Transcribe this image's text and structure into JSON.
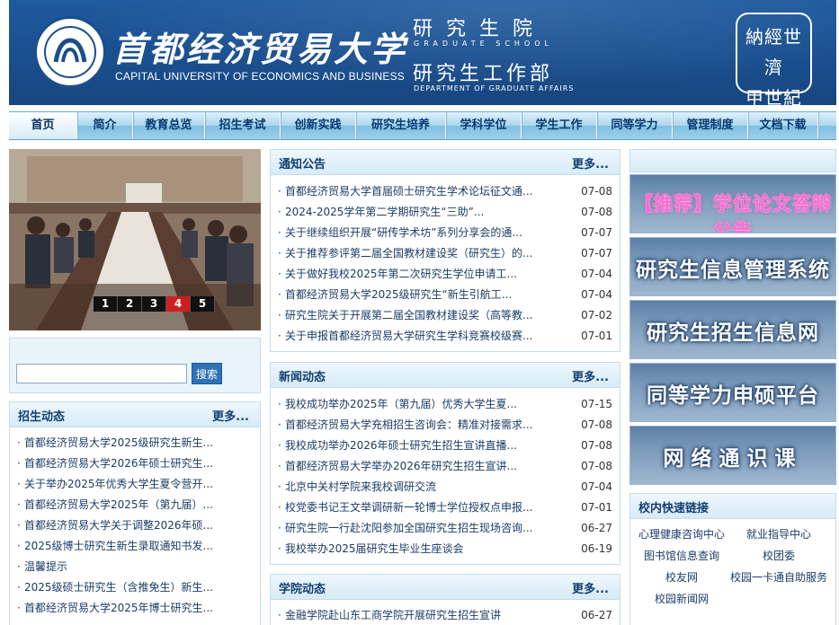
{
  "header": {
    "university_cn": "首都经济贸易大学",
    "university_en": "CAPITAL UNIVERSITY OF ECONOMICS AND BUSINESS",
    "dept1_cn": "研究生院",
    "dept1_en": "GRADUATE SCHOOL",
    "dept2_cn": "研究生工作部",
    "dept2_en": "DEPARTMENT OF GRADUATE AFFAIRS",
    "motto_line1": "納經世濟",
    "motto_line2": "甲世紀忠"
  },
  "nav": [
    {
      "label": "首页",
      "active": true
    },
    {
      "label": "简介"
    },
    {
      "label": "教育总览"
    },
    {
      "label": "招生考试"
    },
    {
      "label": "创新实践"
    },
    {
      "label": "研究生培养"
    },
    {
      "label": "学科学位"
    },
    {
      "label": "学生工作"
    },
    {
      "label": "同等学力"
    },
    {
      "label": "管理制度"
    },
    {
      "label": "文档下载"
    }
  ],
  "slider": {
    "pages": [
      "1",
      "2",
      "3",
      "4",
      "5"
    ],
    "active_page": "4"
  },
  "search": {
    "value": "",
    "button_label": "搜索"
  },
  "notices": {
    "title": "通知公告",
    "more": "更多...",
    "items": [
      {
        "text": "首都经济贸易大学首届硕士研究生学术论坛征文通...",
        "date": "07-08"
      },
      {
        "text": "2024-2025学年第二学期研究生“三助”...",
        "date": "07-08"
      },
      {
        "text": "关于继续组织开展“研传学术坊”系列分享会的通...",
        "date": "07-07"
      },
      {
        "text": "关于推荐参评第二届全国教材建设奖（研究生）的...",
        "date": "07-07"
      },
      {
        "text": "关于做好我校2025年第二次研究生学位申请工...",
        "date": "07-04"
      },
      {
        "text": "首都经济贸易大学2025级研究生“新生引航工...",
        "date": "07-04"
      },
      {
        "text": "研究生院关于开展第二届全国教材建设奖（高等教...",
        "date": "07-02"
      },
      {
        "text": "关于申报首都经济贸易大学研究生学科竞赛校级赛...",
        "date": "07-01"
      }
    ]
  },
  "news": {
    "title": "新闻动态",
    "more": "更多...",
    "items": [
      {
        "text": "我校成功举办2025年（第九届）优秀大学生夏...",
        "date": "07-15"
      },
      {
        "text": "首都经济贸易大学充相招生咨询会：精准对接需求...",
        "date": "07-08"
      },
      {
        "text": "我校成功举办2026年硕士研究生招生宣讲直播...",
        "date": "07-08"
      },
      {
        "text": "首都经济贸易大学举办2026年研究生招生宣讲...",
        "date": "07-08"
      },
      {
        "text": "北京中关村学院来我校调研交流",
        "date": "07-04"
      },
      {
        "text": "校党委书记王文举调研新一轮博士学位授权点申报...",
        "date": "07-01"
      },
      {
        "text": "研究生院一行赴沈阳参加全国研究生招生现场咨询...",
        "date": "06-27"
      },
      {
        "text": "我校举办2025届研究生毕业生座谈会",
        "date": "06-19"
      }
    ]
  },
  "college": {
    "title": "学院动态",
    "more": "更多...",
    "items": [
      {
        "text": "金融学院赴山东工商学院开展研究生招生宣讲",
        "date": "06-27"
      }
    ]
  },
  "admissions": {
    "title": "招生动态",
    "more": "更多...",
    "items": [
      {
        "text": "首都经济贸易大学2025级研究生新生..."
      },
      {
        "text": "首都经济贸易大学2026年硕士研究生..."
      },
      {
        "text": "关于举办2025年优秀大学生夏令营开..."
      },
      {
        "text": "首都经济贸易大学2025年（第九届）..."
      },
      {
        "text": "首都经济贸易大学关于调整2026年硕..."
      },
      {
        "text": "2025级博士研究生新生录取通知书发..."
      },
      {
        "text": "温馨提示"
      },
      {
        "text": "2025级硕士研究生（含推免生）新生..."
      },
      {
        "text": "首都经济贸易大学2025年博士研究生..."
      }
    ]
  },
  "banners": [
    {
      "label": "【推荐】学位论文答辩公告",
      "style": "pink"
    },
    {
      "label": "研究生信息管理系统",
      "style": "normal"
    },
    {
      "label": "研究生招生信息网",
      "style": "normal"
    },
    {
      "label": "同等学力申硕平台",
      "style": "normal"
    },
    {
      "label": "网络通识课",
      "style": "wide"
    }
  ],
  "quick_links": {
    "title": "校内快速链接",
    "items": [
      "心理健康咨询中心",
      "就业指导中心",
      "图书馆信息查询",
      "校团委",
      "校友网",
      "校园一卡通自助服务",
      "校园新闻网"
    ]
  },
  "colors": {
    "header_blue": "#1a4f8f",
    "nav_text": "#0a3a72",
    "link_text": "#1a3c66",
    "pager_active": "#cc2020",
    "banner_pink": "#ff6ad5"
  }
}
